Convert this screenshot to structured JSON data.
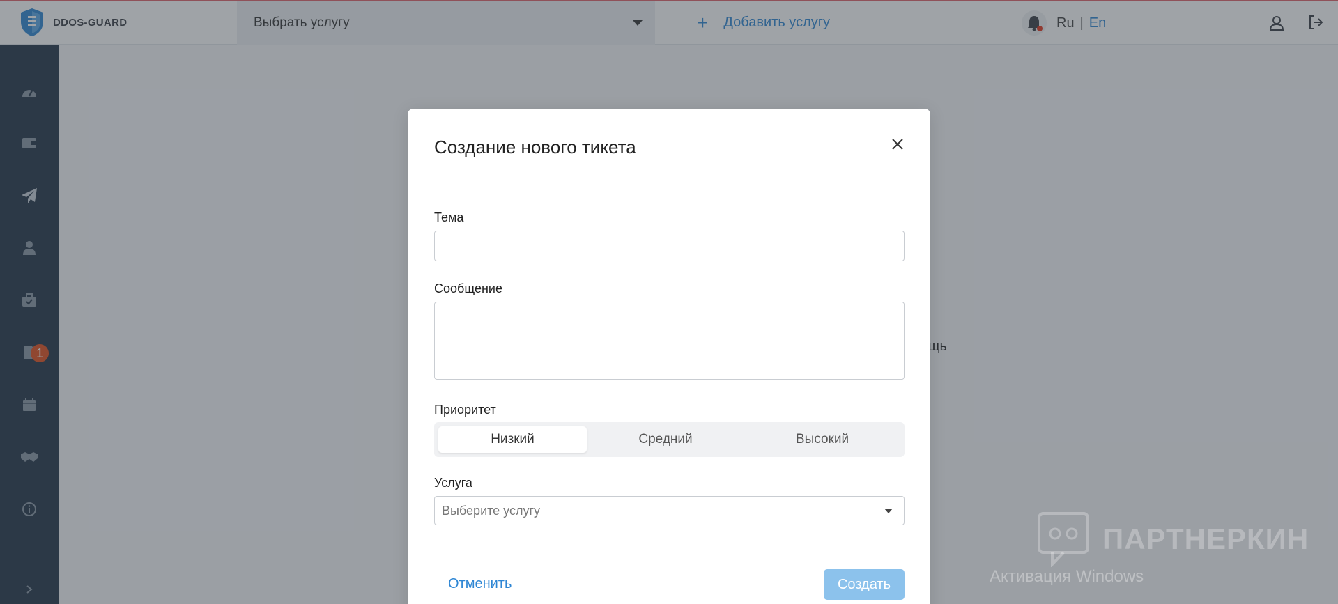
{
  "header": {
    "logo_text": "DDOS-GUARD",
    "service_select": "Выбрать услугу",
    "add_service": "Добавить услугу",
    "lang_ru": "Ru",
    "lang_sep": "|",
    "lang_en": "En",
    "accent": "#2e86d4"
  },
  "sidebar": {
    "items": [
      {
        "icon": "dashboard-icon"
      },
      {
        "icon": "wallet-icon"
      },
      {
        "icon": "paper-plane-icon"
      },
      {
        "icon": "user-icon"
      },
      {
        "icon": "briefcase-icon"
      },
      {
        "icon": "document-icon",
        "badge": "1"
      },
      {
        "icon": "calendar-icon"
      },
      {
        "icon": "handshake-icon"
      },
      {
        "icon": "info-icon"
      },
      {
        "icon": "chevron-right-icon"
      }
    ]
  },
  "main": {
    "partial_text": "щь"
  },
  "modal": {
    "title": "Создание нового тикета",
    "subject_label": "Тема",
    "subject_value": "",
    "message_label": "Сообщение",
    "message_value": "",
    "priority_label": "Приоритет",
    "priority_options": [
      "Низкий",
      "Средний",
      "Высокий"
    ],
    "priority_selected": "Низкий",
    "service_label": "Услуга",
    "service_placeholder": "Выберите услугу",
    "cancel_label": "Отменить",
    "create_label": "Создать"
  },
  "watermark": {
    "text": "ПАРТНЕРКИН",
    "windows_activation": "Активация Windows"
  }
}
